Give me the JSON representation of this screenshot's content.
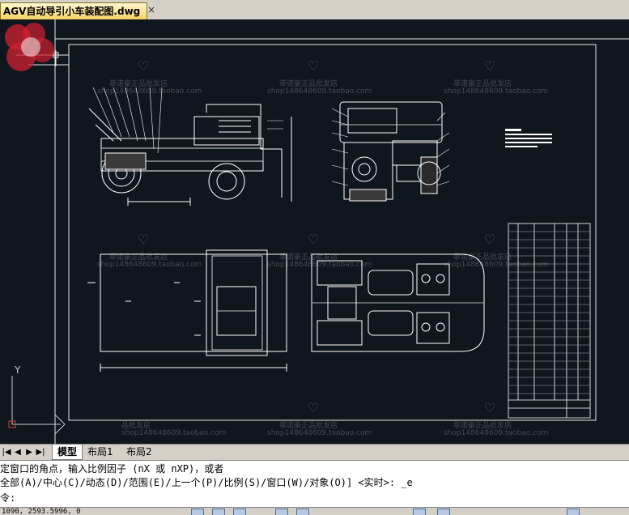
{
  "document_tab": {
    "title": "AGV自动导引小车装配图.dwg",
    "close_glyph": "×"
  },
  "watermark": {
    "shop_name": "菲诺豪正品批发店",
    "shop_url": "shop148648609.taobao.com",
    "short": "品批发店",
    "short_url": "shop148648609.taobao.com"
  },
  "layout_tabs": {
    "nav": [
      "|◀",
      "◀",
      "▶",
      "▶|"
    ],
    "tabs": [
      {
        "label": "模型",
        "active": true
      },
      {
        "label": "布局1",
        "active": false
      },
      {
        "label": "布局2",
        "active": false
      }
    ]
  },
  "command_lines": [
    "定窗口的角点，输入比例因子 (nX 或 nXP)，或者",
    "全部(A)/中心(C)/动态(D)/范围(E)/上一个(P)/比例(S)/窗口(W)/对象(O)] <实时>: _e",
    "令:"
  ],
  "status_bar": {
    "coordinates": "1090, 2593.5996, 0"
  },
  "ucs_label": "Y",
  "colors": {
    "canvas": "#10161e",
    "tab_active": "#f2d060",
    "drawing_line": "#ffffff",
    "frame_line": "#e8e8e8",
    "ucs": "#c8c8c8",
    "stamp": "#d02030"
  },
  "icons": [
    "close-icon",
    "ucs-icon",
    "heart-watermark-icon",
    "stamp-logo",
    "status-toolbar-icons"
  ]
}
